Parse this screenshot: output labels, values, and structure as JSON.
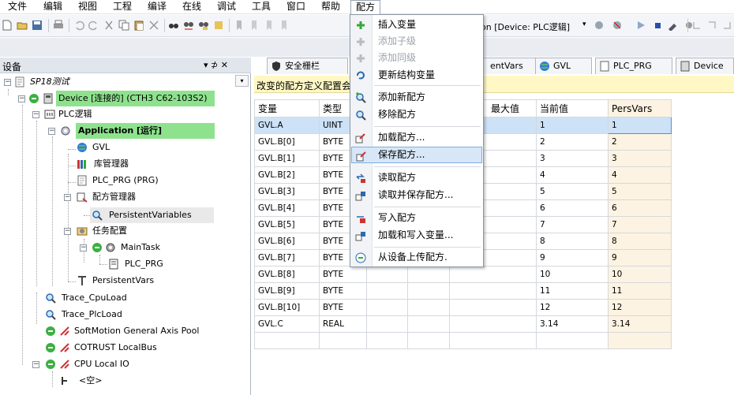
{
  "menu": [
    "文件",
    "编辑",
    "视图",
    "工程",
    "编译",
    "在线",
    "调试",
    "工具",
    "窗口",
    "帮助",
    "配方"
  ],
  "toolbar": {
    "device_text": "on [Device: PLC逻辑]",
    "arrow": "▾"
  },
  "devices_panel": {
    "title": "设备",
    "pin": "▾ ⊅ ✕",
    "dropdown": "▾"
  },
  "tree": {
    "root": "SP18测试",
    "device": "Device [连接的] (CTH3 C62-103S2)",
    "plc": "PLC逻辑",
    "app": "Application [运行]",
    "gvl": "GVL",
    "lib": "库管理器",
    "plcprg": "PLC_PRG (PRG)",
    "recipe_mgr": "配方管理器",
    "persistent_variables": "PersistentVariables",
    "task_cfg": "任务配置",
    "main_task": "MainTask",
    "main_task_prg": "PLC_PRG",
    "persistent_vars": "PersistentVars",
    "trace_cpu": "Trace_CpuLoad",
    "trace_plc": "Trace_PlcLoad",
    "softmotion": "SoftMotion General Axis Pool",
    "localbus": "COTRUST LocalBus",
    "localio": "CPU Local IO",
    "empty": "<空>"
  },
  "tabs": [
    "安全栅栏",
    "entVars",
    "GVL",
    "PLC_PRG",
    "Device"
  ],
  "info_text": "改变的配方定义配置会",
  "recipe_table": {
    "headers": [
      "变量",
      "类型",
      "",
      "",
      "最大值",
      "当前值",
      "PersVars"
    ],
    "rows": [
      [
        "GVL.A",
        "UINT",
        "1",
        "1"
      ],
      [
        "GVL.B[0]",
        "BYTE",
        "2",
        "2"
      ],
      [
        "GVL.B[1]",
        "BYTE",
        "3",
        "3"
      ],
      [
        "GVL.B[2]",
        "BYTE",
        "4",
        "4"
      ],
      [
        "GVL.B[3]",
        "BYTE",
        "5",
        "5"
      ],
      [
        "GVL.B[4]",
        "BYTE",
        "6",
        "6"
      ],
      [
        "GVL.B[5]",
        "BYTE",
        "7",
        "7"
      ],
      [
        "GVL.B[6]",
        "BYTE",
        "8",
        "8"
      ],
      [
        "GVL.B[7]",
        "BYTE",
        "9",
        "9"
      ],
      [
        "GVL.B[8]",
        "BYTE",
        "10",
        "10"
      ],
      [
        "GVL.B[9]",
        "BYTE",
        "11",
        "11"
      ],
      [
        "GVL.B[10]",
        "BYTE",
        "12",
        "12"
      ],
      [
        "GVL.C",
        "REAL",
        "3.14",
        "3.14"
      ],
      [
        "",
        "",
        "",
        ""
      ]
    ]
  },
  "recipe_menu": [
    {
      "label": "插入变量",
      "disabled": false
    },
    {
      "label": "添加子级",
      "disabled": true
    },
    {
      "label": "添加同级",
      "disabled": true
    },
    {
      "label": "更新结构变量",
      "disabled": false
    },
    {
      "label": "添加新配方",
      "disabled": false
    },
    {
      "label": "移除配方",
      "disabled": false
    },
    {
      "label": "加载配方...",
      "disabled": false
    },
    {
      "label": "保存配方...",
      "disabled": false,
      "highlight": true
    },
    {
      "label": "读取配方",
      "disabled": false
    },
    {
      "label": "读取并保存配方...",
      "disabled": false
    },
    {
      "label": "写入配方",
      "disabled": false
    },
    {
      "label": "加载和写入变量...",
      "disabled": false
    },
    {
      "label": "从设备上传配方.",
      "disabled": false
    }
  ],
  "colors": {
    "highlight_green": "#8ee28e",
    "selection_blue": "#cde2f7",
    "info_yellow": "#fff7c4",
    "pers_col": "#fdf3e2"
  }
}
